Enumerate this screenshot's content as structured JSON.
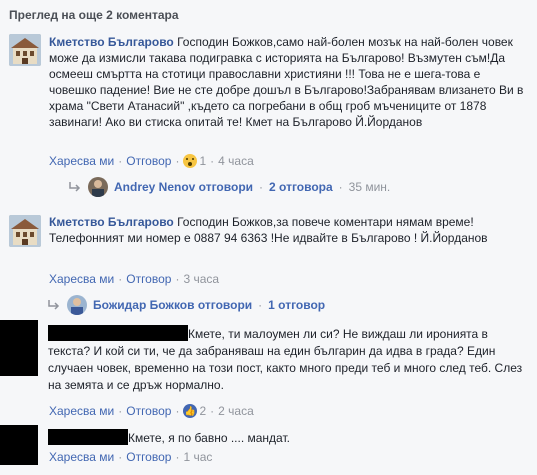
{
  "header": {
    "more_comments": "Преглед на още 2 коментара"
  },
  "comments": [
    {
      "author": "Кметство Българово",
      "text": "Господин Божков,само най-болен мозък на най-болен човек може да измисли такава подигравка с историята на Българово! Възмутен съм!Да осмееш смъртта на стотици православни християни !!! Това не е шега-това е човешко падение! Вие не сте добре дошъл в Българово!Забранявам влизането Ви в храма \"Свети Атанасий\" ,където са погребани в общ гроб мъчениците от 1878 завинаги! Ако ви стиска опитай те! Кмет на Българово Й.Йорданов",
      "like": "Харесва ми",
      "reply": "Отговор",
      "reaction_count": "1",
      "time": "4 часа",
      "replies_summary": {
        "who": "Andrey Nenov отговори",
        "count": "2 отговора",
        "time": "35 мин."
      }
    },
    {
      "author": "Кметство Българово",
      "text": "Господин Божков,за повече коментари нямам време! Телефонният ми номер е 0887 94 6363 !Не идвайте в Българово ! Й.Йорданов",
      "like": "Харесва ми",
      "reply": "Отговор",
      "time": "3 часа",
      "replies_summary": {
        "who": "Божидар Божков отговори",
        "count": "1 отговор"
      }
    },
    {
      "text": "Кмете, ти малоумен ли си? Не виждаш ли иронията в текста? И кой си ти, че да забраняваш на един българин да идва в града? Един случаен човек, временно на този пост, както много преди теб и много след теб. Слез на земята и се дръж нормално.",
      "like": "Харесва ми",
      "reply": "Отговор",
      "reaction_count": "2",
      "time": "2 часа"
    },
    {
      "text": "Кмете, я по бавно .... мандат.",
      "like": "Харесва ми",
      "reply": "Отговор",
      "time": "1 час"
    }
  ],
  "colors": {
    "link": "#4267b2",
    "author": "#365899",
    "muted": "#90949c",
    "bg": "#f6f7f9"
  }
}
